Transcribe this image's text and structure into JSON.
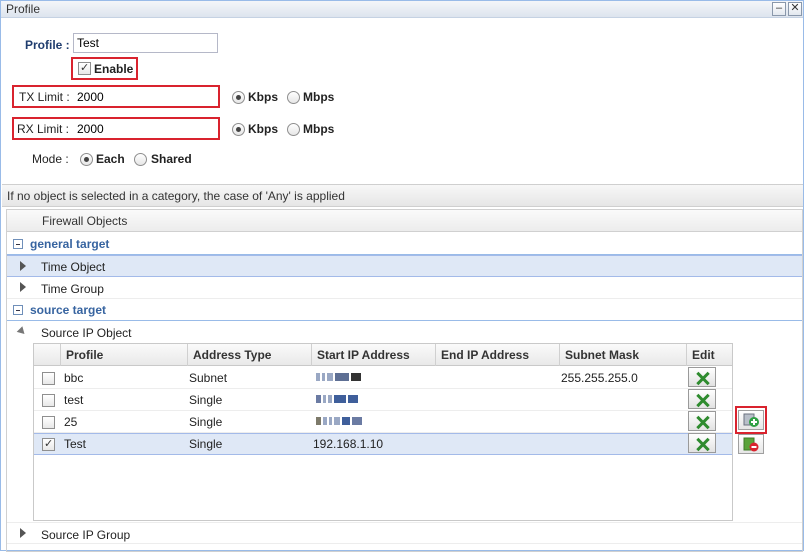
{
  "window": {
    "title": "Profile"
  },
  "form": {
    "profile_label": "Profile :",
    "profile_value": "Test",
    "enable_label": "Enable",
    "tx_label": "TX Limit :",
    "tx_value": "2000",
    "rx_label": "RX Limit :",
    "rx_value": "2000",
    "kbps": "Kbps",
    "mbps": "Mbps",
    "mode_label": "Mode :",
    "mode_each": "Each",
    "mode_shared": "Shared"
  },
  "info": "If no object is selected in a category, the case of 'Any' is applied",
  "tree": {
    "header": "Firewall Objects",
    "general_target": "general target",
    "time_object": "Time Object",
    "time_group": "Time Group",
    "source_target": "source target",
    "source_ip_object": "Source IP Object",
    "source_ip_group": "Source IP Group"
  },
  "table": {
    "columns": [
      "Profile",
      "Address Type",
      "Start IP Address",
      "End IP Address",
      "Subnet Mask",
      "Edit"
    ],
    "rows": [
      {
        "profile": "bbc",
        "type": "Subnet",
        "start": "",
        "end": "",
        "mask": "255.255.255.0",
        "checked": false
      },
      {
        "profile": "test",
        "type": "Single",
        "start": "",
        "end": "",
        "mask": "",
        "checked": false
      },
      {
        "profile": "25",
        "type": "Single",
        "start": "",
        "end": "",
        "mask": "",
        "checked": false
      },
      {
        "profile": "Test",
        "type": "Single",
        "start": "192.168.1.10",
        "end": "",
        "mask": "",
        "checked": true
      }
    ]
  },
  "colors": {
    "highlight": "#d9232e",
    "accent": "#3764a0",
    "selected_row": "#dfe8f6"
  },
  "icons": [
    "minimize-icon",
    "close-icon",
    "wrench-icon",
    "add-object-icon",
    "delete-object-icon"
  ]
}
